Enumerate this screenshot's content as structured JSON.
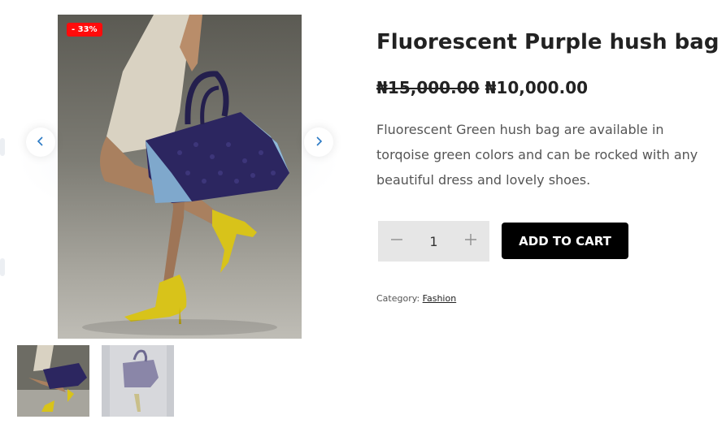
{
  "gallery": {
    "badge": "- 33%",
    "prev_icon": "chevron-left-icon",
    "next_icon": "chevron-right-icon",
    "thumbnails": [
      "thumbnail-1",
      "thumbnail-2"
    ]
  },
  "product": {
    "title": "Fluorescent Purple hush bag",
    "price_old": "₦15,000.00",
    "price_new": "₦10,000.00",
    "description": "Fluorescent Green hush bag are available in torqoise green colors and can be rocked with any beautiful dress and lovely shoes.",
    "quantity": "1",
    "decrement_icon": "minus-icon",
    "increment_icon": "plus-icon",
    "add_to_cart": "ADD TO CART",
    "category_label": "Category:",
    "category_value": "Fashion"
  },
  "colors": {
    "badge": "#ff0b0b",
    "button": "#000000",
    "qty_bg": "#e6e6e6",
    "arrow": "#2a79c4",
    "shoes": "#d8c31a",
    "bag": "#2c2660"
  }
}
